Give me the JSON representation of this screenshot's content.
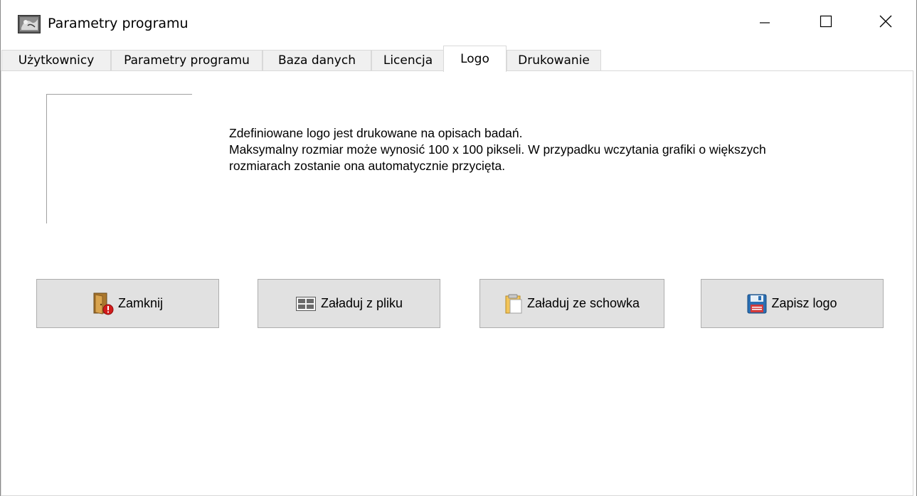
{
  "window": {
    "title": "Parametry programu",
    "controls": {
      "minimize": "minimize-icon",
      "maximize": "maximize-icon",
      "close": "close-icon"
    }
  },
  "tabs": [
    {
      "label": "Użytkownicy",
      "active": false
    },
    {
      "label": "Parametry programu",
      "active": false
    },
    {
      "label": "Baza danych",
      "active": false
    },
    {
      "label": "Licencja",
      "active": false
    },
    {
      "label": "Logo",
      "active": true
    },
    {
      "label": "Drukowanie",
      "active": false
    }
  ],
  "logo_panel": {
    "info_lines": [
      "Zdefiniowane logo jest drukowane na opisach badań.",
      "Maksymalny rozmiar może wynosić 100 x 100 pikseli. W przypadku wczytania grafiki o większych",
      "rozmiarach zostanie ona automatycznie przycięta."
    ]
  },
  "buttons": {
    "close": {
      "label": "Zamknij",
      "icon": "door-exit-icon"
    },
    "load_file": {
      "label": "Załaduj z pliku",
      "icon": "file-grid-icon"
    },
    "load_clipboard": {
      "label": "Załaduj ze schowka",
      "icon": "clipboard-icon"
    },
    "save": {
      "label": "Zapisz logo",
      "icon": "floppy-disk-icon"
    }
  },
  "colors": {
    "button_face": "#e1e1e1",
    "button_border": "#adadad",
    "tab_inactive": "#f0f0f0",
    "floppy_blue": "#2b6fb3"
  }
}
